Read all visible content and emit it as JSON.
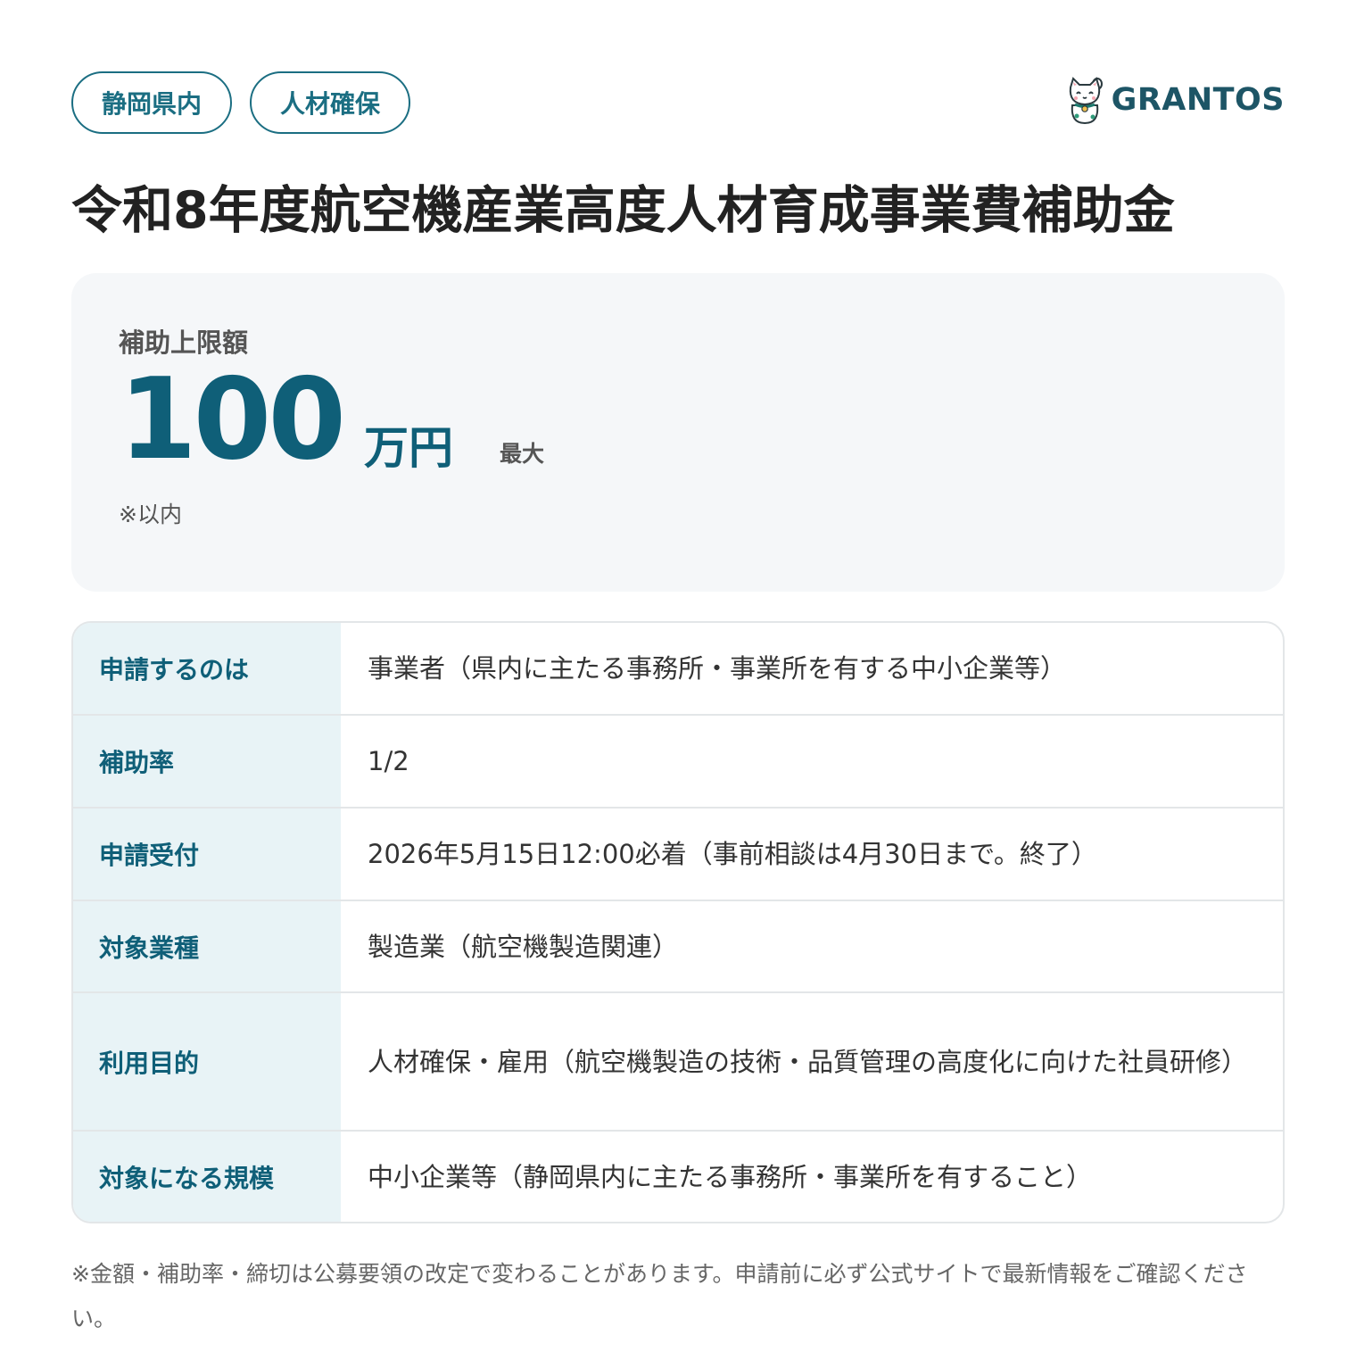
{
  "tags": [
    "静岡県内",
    "人材確保"
  ],
  "logo": {
    "icon": "maneki-neko-cat-icon",
    "text": "GRANTOS"
  },
  "title": "令和8年度航空機産業高度人材育成事業費補助金",
  "amount": {
    "label": "補助上限額",
    "value": "100",
    "unit": "万円",
    "qualifier": "最大",
    "note": "※以内"
  },
  "details": [
    {
      "label": "申請するのは",
      "value": "事業者（県内に主たる事務所・事業所を有する中小企業等）"
    },
    {
      "label": "補助率",
      "value": "1/2"
    },
    {
      "label": "申請受付",
      "value": "2026年5月15日12:00必着（事前相談は4月30日まで。終了）"
    },
    {
      "label": "対象業種",
      "value": "製造業（航空機製造関連）"
    },
    {
      "label": "利用目的",
      "value": "人材確保・雇用（航空機製造の技術・品質管理の高度化に向けた社員研修）"
    },
    {
      "label": "対象になる規模",
      "value": "中小企業等（静岡県内に主たる事務所・事業所を有すること）"
    }
  ],
  "footnote": "※金額・補助率・締切は公募要領の改定で変わることがあります。申請前に必ず公式サイトで最新情報をご確認ください。",
  "colors": {
    "accent": "#0f5f78",
    "tag_border": "#1b6e82",
    "label_bg": "#e8f3f6",
    "card_bg": "#f5f7f9"
  }
}
